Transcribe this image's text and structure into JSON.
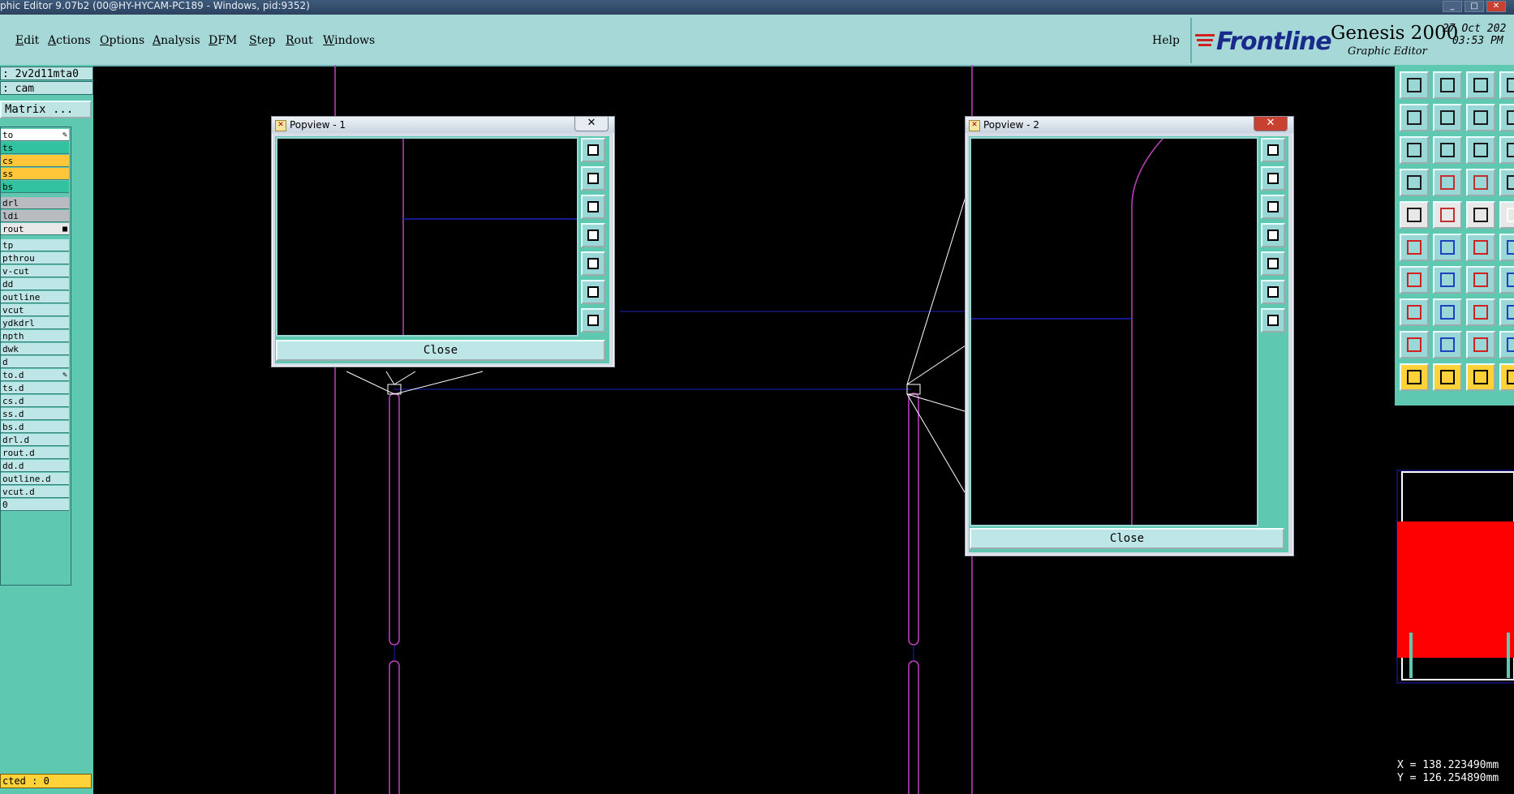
{
  "window": {
    "title": "phic Editor 9.07b2 (00@HY-HYCAM-PC189 - Windows, pid:9352)"
  },
  "menu": {
    "items": [
      "Edit",
      "Actions",
      "Options",
      "Analysis",
      "DFM",
      "Step",
      "Rout",
      "Windows"
    ],
    "help": "Help"
  },
  "brand": {
    "logo": "Frontline",
    "product": "Genesis 2000",
    "subtitle": "Graphic Editor",
    "date": "27 Oct 202",
    "time": "03:53 PM"
  },
  "left_panel": {
    "job": ": 2v2d11mta0",
    "step": ": cam",
    "matrix_button": "Matrix ...",
    "layers": [
      {
        "name": "to",
        "color": "#ffffff",
        "mark": "pen"
      },
      {
        "name": "ts",
        "color": "#33c2a0"
      },
      {
        "name": "cs",
        "color": "#ffc63a"
      },
      {
        "name": "ss",
        "color": "#ffc63a"
      },
      {
        "name": "bs",
        "color": "#33c2a0"
      },
      {
        "name": "drl",
        "color": "#b8bcc0"
      },
      {
        "name": "ldi",
        "color": "#b8bcc0"
      },
      {
        "name": "rout",
        "color": "#e8e8e8",
        "mark": "dot"
      },
      {
        "name": "tp",
        "color": "#bfe6e6"
      },
      {
        "name": "pthrou",
        "color": "#bfe6e6"
      },
      {
        "name": "v-cut",
        "color": "#bfe6e6"
      },
      {
        "name": "dd",
        "color": "#bfe6e6"
      },
      {
        "name": "outline",
        "color": "#bfe6e6"
      },
      {
        "name": "vcut",
        "color": "#bfe6e6"
      },
      {
        "name": "ydkdrl",
        "color": "#bfe6e6"
      },
      {
        "name": "npth",
        "color": "#bfe6e6"
      },
      {
        "name": "dwk",
        "color": "#bfe6e6"
      },
      {
        "name": "d",
        "color": "#bfe6e6"
      },
      {
        "name": "to.d",
        "color": "#bfe6e6",
        "mark": "pen"
      },
      {
        "name": "ts.d",
        "color": "#bfe6e6"
      },
      {
        "name": "cs.d",
        "color": "#bfe6e6"
      },
      {
        "name": "ss.d",
        "color": "#bfe6e6"
      },
      {
        "name": "bs.d",
        "color": "#bfe6e6"
      },
      {
        "name": "drl.d",
        "color": "#bfe6e6"
      },
      {
        "name": "rout.d",
        "color": "#bfe6e6"
      },
      {
        "name": "dd.d",
        "color": "#bfe6e6"
      },
      {
        "name": "outline.d",
        "color": "#bfe6e6"
      },
      {
        "name": "vcut.d",
        "color": "#bfe6e6"
      },
      {
        "name": "0",
        "color": "#bfe6e6"
      }
    ],
    "selected_status": "cted : 0"
  },
  "popview1": {
    "title": "Popview - 1",
    "close_label": "Close",
    "close_x": "✕"
  },
  "popview2": {
    "title": "Popview - 2",
    "close_label": "Close",
    "close_x": "✕"
  },
  "coords": {
    "x": "X = 138.223490mm",
    "y": "Y = 126.254890mm"
  },
  "colors": {
    "menubar": "#a6d8d8",
    "panel": "#5fc8b0",
    "rout_line": "#c040c0",
    "pad_line": "#2020c0",
    "overview_fill": "#ff0000"
  }
}
